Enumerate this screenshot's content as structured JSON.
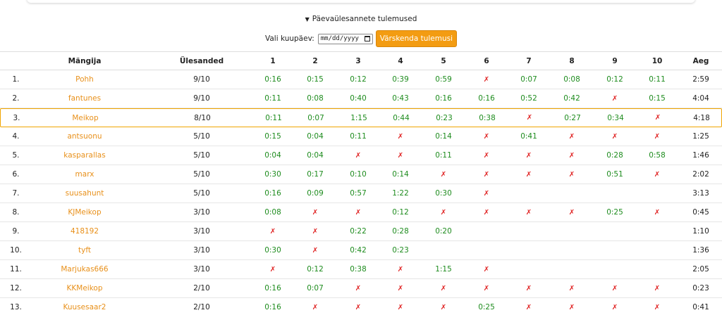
{
  "summary": {
    "arrow": "▼",
    "title": "Päevaülesannete tulemused"
  },
  "controls": {
    "date_label": "Vali kuupäev:",
    "date_placeholder": "mm/dd/yyyy",
    "refresh_label": "Värskenda tulemusi"
  },
  "columns": {
    "player": "Mängija",
    "tasks": "Ülesanded",
    "t1": "1",
    "t2": "2",
    "t3": "3",
    "t4": "4",
    "t5": "5",
    "t6": "6",
    "t7": "7",
    "t8": "8",
    "t9": "9",
    "t10": "10",
    "time": "Aeg"
  },
  "fail_mark": "✗",
  "highlight_player": "Meikop",
  "rows": [
    {
      "rank": "1.",
      "name": "Pohh",
      "tasks": "9/10",
      "results": [
        "0:16",
        "0:15",
        "0:12",
        "0:39",
        "0:59",
        "x",
        "0:07",
        "0:08",
        "0:12",
        "0:11"
      ],
      "time": "2:59"
    },
    {
      "rank": "2.",
      "name": "fantunes",
      "tasks": "9/10",
      "results": [
        "0:11",
        "0:08",
        "0:40",
        "0:43",
        "0:16",
        "0:16",
        "0:52",
        "0:42",
        "x",
        "0:15"
      ],
      "time": "4:04"
    },
    {
      "rank": "3.",
      "name": "Meikop",
      "tasks": "8/10",
      "results": [
        "0:11",
        "0:07",
        "1:15",
        "0:44",
        "0:23",
        "0:38",
        "x",
        "0:27",
        "0:34",
        "x"
      ],
      "time": "4:18"
    },
    {
      "rank": "4.",
      "name": "antsuonu",
      "tasks": "5/10",
      "results": [
        "0:15",
        "0:04",
        "0:11",
        "x",
        "0:14",
        "x",
        "0:41",
        "x",
        "x",
        "x"
      ],
      "time": "1:25"
    },
    {
      "rank": "5.",
      "name": "kasparallas",
      "tasks": "5/10",
      "results": [
        "0:04",
        "0:04",
        "x",
        "x",
        "0:11",
        "x",
        "x",
        "x",
        "0:28",
        "0:58"
      ],
      "time": "1:46"
    },
    {
      "rank": "6.",
      "name": "marx",
      "tasks": "5/10",
      "results": [
        "0:30",
        "0:17",
        "0:10",
        "0:14",
        "x",
        "x",
        "x",
        "x",
        "0:51",
        "x"
      ],
      "time": "2:02"
    },
    {
      "rank": "7.",
      "name": "suusahunt",
      "tasks": "5/10",
      "results": [
        "0:16",
        "0:09",
        "0:57",
        "1:22",
        "0:30",
        "x",
        "",
        "",
        "",
        ""
      ],
      "time": "3:13"
    },
    {
      "rank": "8.",
      "name": "KJMeikop",
      "tasks": "3/10",
      "results": [
        "0:08",
        "x",
        "x",
        "0:12",
        "x",
        "x",
        "x",
        "x",
        "0:25",
        "x"
      ],
      "time": "0:45"
    },
    {
      "rank": "9.",
      "name": "418192",
      "tasks": "3/10",
      "results": [
        "x",
        "x",
        "0:22",
        "0:28",
        "0:20",
        "",
        "",
        "",
        "",
        ""
      ],
      "time": "1:10"
    },
    {
      "rank": "10.",
      "name": "tyft",
      "tasks": "3/10",
      "results": [
        "0:30",
        "x",
        "0:42",
        "0:23",
        "",
        "",
        "",
        "",
        "",
        ""
      ],
      "time": "1:36"
    },
    {
      "rank": "11.",
      "name": "Marjukas666",
      "tasks": "3/10",
      "results": [
        "x",
        "0:12",
        "0:38",
        "x",
        "1:15",
        "x",
        "",
        "",
        "",
        ""
      ],
      "time": "2:05"
    },
    {
      "rank": "12.",
      "name": "KKMeikop",
      "tasks": "2/10",
      "results": [
        "0:16",
        "0:07",
        "x",
        "x",
        "x",
        "x",
        "x",
        "x",
        "x",
        "x"
      ],
      "time": "0:23"
    },
    {
      "rank": "13.",
      "name": "Kuusesaar2",
      "tasks": "2/10",
      "results": [
        "0:16",
        "x",
        "x",
        "x",
        "x",
        "0:25",
        "x",
        "x",
        "x",
        "x"
      ],
      "time": "0:41"
    }
  ]
}
